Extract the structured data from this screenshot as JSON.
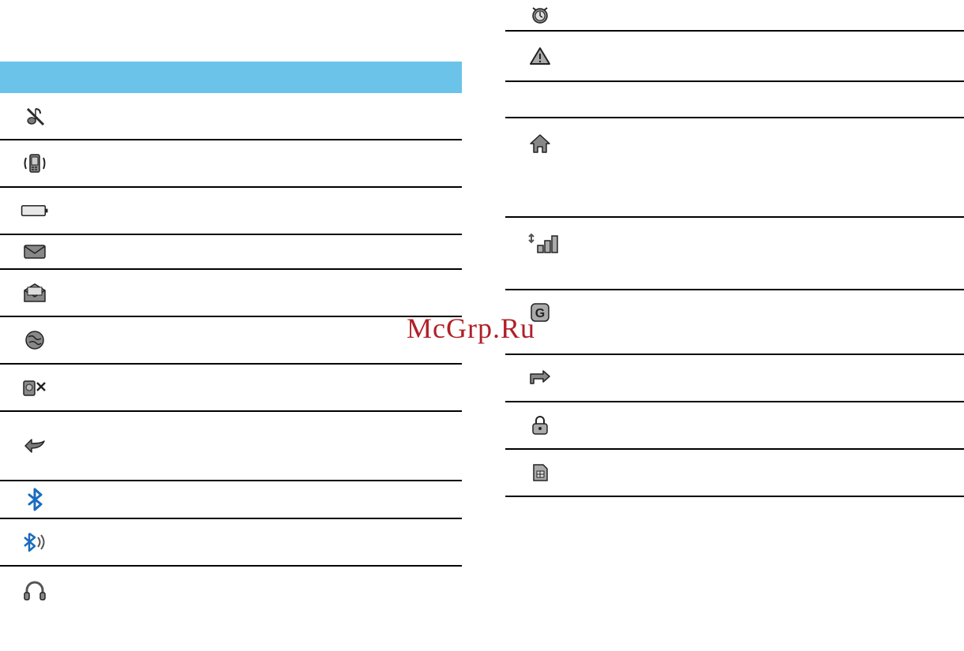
{
  "watermark": "McGrp.Ru",
  "left_icons": [
    "muted-note-icon",
    "vibrate-phone-icon",
    "battery-icon",
    "envelope-icon",
    "envelope-open-icon",
    "globe-java-icon",
    "camera-cancel-icon",
    "reply-arrow-icon",
    "bluetooth-icon",
    "bluetooth-audio-icon",
    "headphones-icon"
  ],
  "right_icons": [
    "alarm-clock-icon",
    "warning-triangle-icon",
    "home-icon",
    "signal-bars-icon",
    "gprs-g-icon",
    "forward-arrow-icon",
    "lock-icon",
    "sim-card-icon"
  ]
}
